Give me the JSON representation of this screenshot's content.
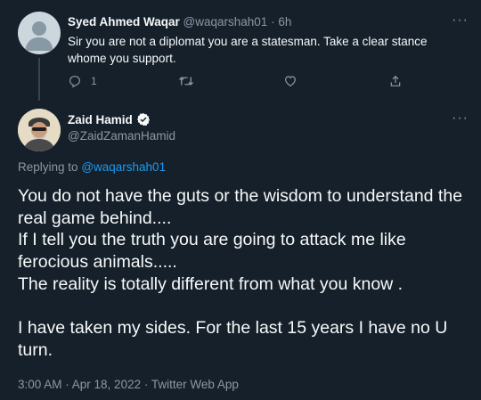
{
  "reply": {
    "display_name": "Syed Ahmed Waqar",
    "handle": "@waqarshah01",
    "separator": "·",
    "time": "6h",
    "text": "Sir you are not a diplomat you are a statesman. Take a clear stance whome you support.",
    "reply_count": "1",
    "icons": [
      "reply-icon",
      "retweet-icon",
      "like-icon",
      "share-icon",
      "more-icon"
    ]
  },
  "tweet": {
    "display_name": "Zaid Hamid",
    "verified_icon": "verified-badge-icon",
    "handle": "@ZaidZamanHamid",
    "replying_to_prefix": "Replying to",
    "replying_to_handle": "@waqarshah01",
    "text": "You do not have the guts or the wisdom to understand the real game behind....\nIf I tell you the truth you are going to attack me like ferocious animals.....\nThe reality is totally different from what you know .\n\nI have taken my sides. For the last 15 years I have no U turn.",
    "timestamp": "3:00 AM · Apr 18, 2022 · Twitter Web App"
  },
  "colors": {
    "background": "#15202b",
    "text": "#f7f9f9",
    "muted": "#8b98a5",
    "link": "#1d9bf0",
    "divider": "#38444d"
  }
}
